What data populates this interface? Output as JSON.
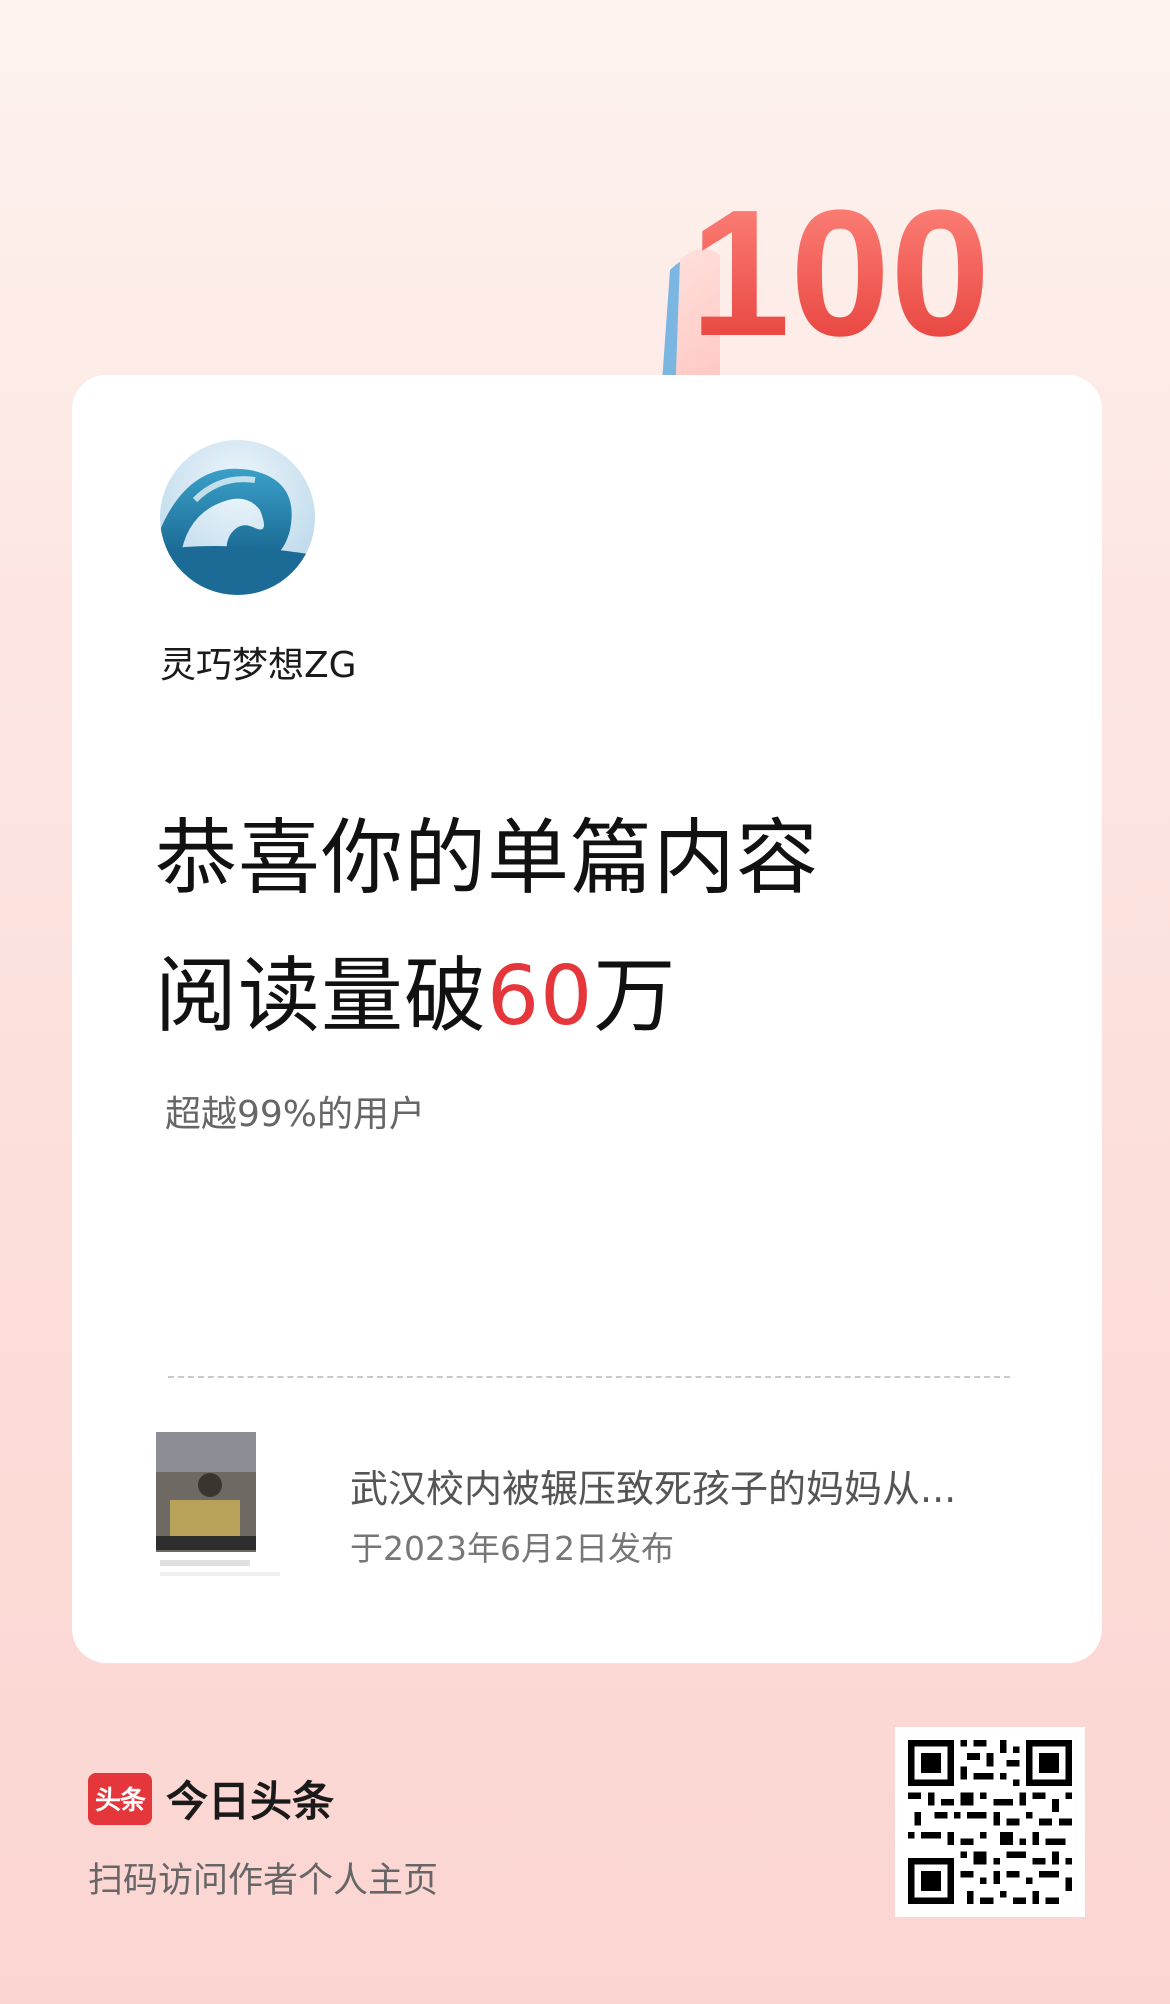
{
  "badge": {
    "number": "100"
  },
  "profile": {
    "username": "灵巧梦想ZG"
  },
  "headline": {
    "line1": "恭喜你的单篇内容",
    "line2_prefix": "阅读量破",
    "line2_number": "60",
    "line2_suffix": "万"
  },
  "subtext": "超越99%的用户",
  "article": {
    "title": "武汉校内被辗压致死孩子的妈妈从...",
    "date": "于2023年6月2日发布"
  },
  "footer": {
    "brand_logo_text": "头条",
    "brand_name": "今日头条",
    "tagline": "扫码访问作者个人主页"
  },
  "colors": {
    "accent": "#e5363b",
    "background_top": "#fdf3ef",
    "background_bottom": "#fbd5d2"
  },
  "icons": {
    "badge": "hundred-badge-icon",
    "heart": "heart-icon",
    "avatar": "wave-avatar",
    "qr": "qr-code-icon"
  }
}
